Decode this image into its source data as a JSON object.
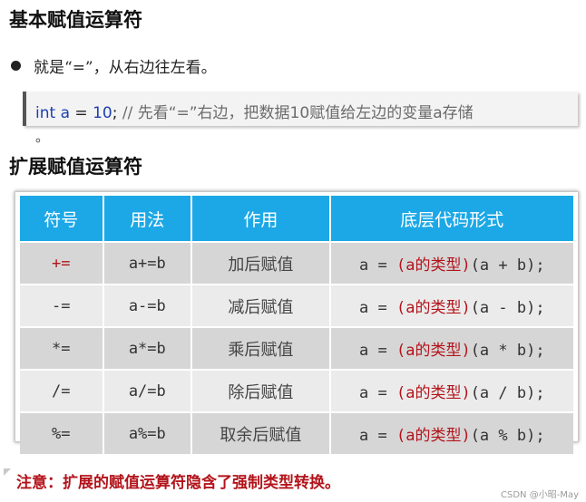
{
  "section1": {
    "title": "基本赋值运算符",
    "bullet": "就是“=”，从右边往左看。"
  },
  "code_example": {
    "keyword": "int",
    "var": "a",
    "op": "=",
    "value": "10",
    "semicolon": ";",
    "comment": "// 先看“=”右边，把数据10赋值给左边的变量a存储",
    "trailing": "。"
  },
  "section2": {
    "title": "扩展赋值运算符"
  },
  "table": {
    "headers": [
      "符号",
      "用法",
      "作用",
      "底层代码形式"
    ],
    "rows": [
      {
        "symbol": "+=",
        "usage": "a+=b",
        "desc": "加后赋值",
        "code_a": "a = ",
        "code_red": "(a的类型)",
        "code_b": "(a + b);"
      },
      {
        "symbol": "-=",
        "usage": "a-=b",
        "desc": "减后赋值",
        "code_a": "a = ",
        "code_red": "(a的类型)",
        "code_b": "(a - b);"
      },
      {
        "symbol": "*=",
        "usage": "a*=b",
        "desc": "乘后赋值",
        "code_a": "a = ",
        "code_red": "(a的类型)",
        "code_b": "(a * b);"
      },
      {
        "symbol": "/=",
        "usage": "a/=b",
        "desc": "除后赋值",
        "code_a": "a = ",
        "code_red": "(a的类型)",
        "code_b": "(a / b);"
      },
      {
        "symbol": "%=",
        "usage": "a%=b",
        "desc": "取余后赋值",
        "code_a": "a = ",
        "code_red": "(a的类型)",
        "code_b": "(a % b);"
      }
    ]
  },
  "note": "注意：扩展的赋值运算符隐含了强制类型转换。",
  "watermark": "CSDN @小昭-May",
  "colors": {
    "header_bg": "#1ca8e6",
    "accent_red": "#b3141b",
    "code_blue": "#1d3fb0"
  }
}
